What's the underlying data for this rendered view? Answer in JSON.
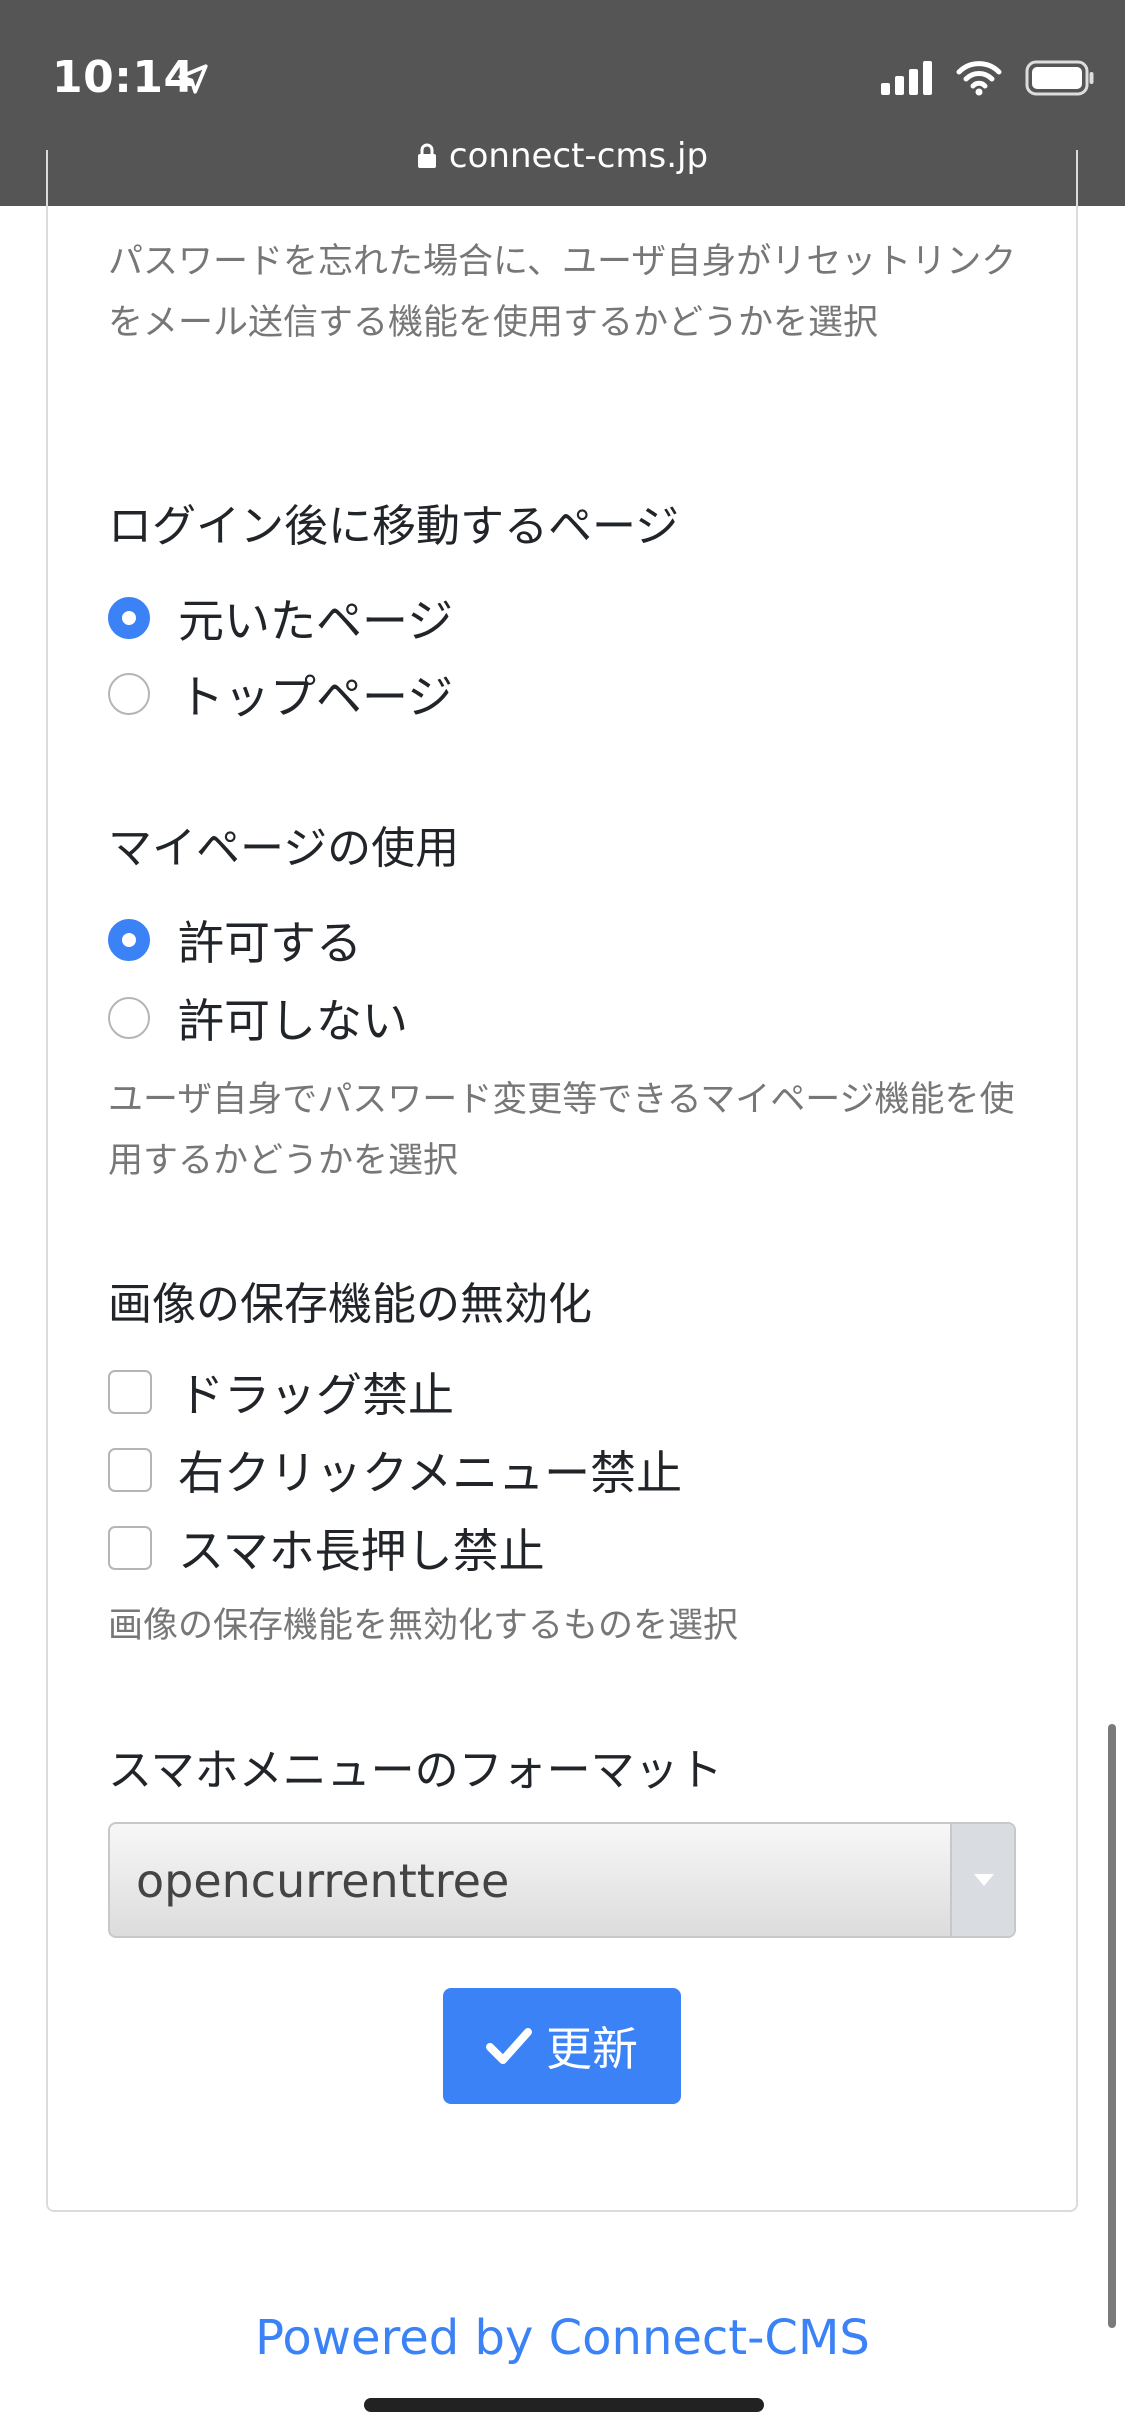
{
  "status_bar": {
    "time": "10:14",
    "url": "connect-cms.jp",
    "icons": [
      "location-arrow-icon",
      "cellular-signal-icon",
      "wifi-icon",
      "battery-icon"
    ]
  },
  "password_reset": {
    "help": "パスワードを忘れた場合に、ユーザ自身がリセットリンクをメール送信する機能を使用するかどうかを選択"
  },
  "login_redirect": {
    "label": "ログイン後に移動するページ",
    "options": [
      {
        "label": "元いたページ",
        "checked": true
      },
      {
        "label": "トップページ",
        "checked": false
      }
    ]
  },
  "mypage": {
    "label": "マイページの使用",
    "options": [
      {
        "label": "許可する",
        "checked": true
      },
      {
        "label": "許可しない",
        "checked": false
      }
    ],
    "help": "ユーザ自身でパスワード変更等できるマイページ機能を使用するかどうかを選択"
  },
  "image_save": {
    "label": "画像の保存機能の無効化",
    "options": [
      {
        "label": "ドラッグ禁止",
        "checked": false
      },
      {
        "label": "右クリックメニュー禁止",
        "checked": false
      },
      {
        "label": "スマホ長押し禁止",
        "checked": false
      }
    ],
    "help": "画像の保存機能を無効化するものを選択"
  },
  "smartphone_menu": {
    "label": "スマホメニューのフォーマット",
    "selected": "opencurrenttree"
  },
  "submit": {
    "label": "更新"
  },
  "footer": {
    "powered": "Powered by Connect-CMS"
  },
  "colors": {
    "status_bar_bg": "#555555",
    "accent": "#3b82f6",
    "help_text": "#777777"
  }
}
